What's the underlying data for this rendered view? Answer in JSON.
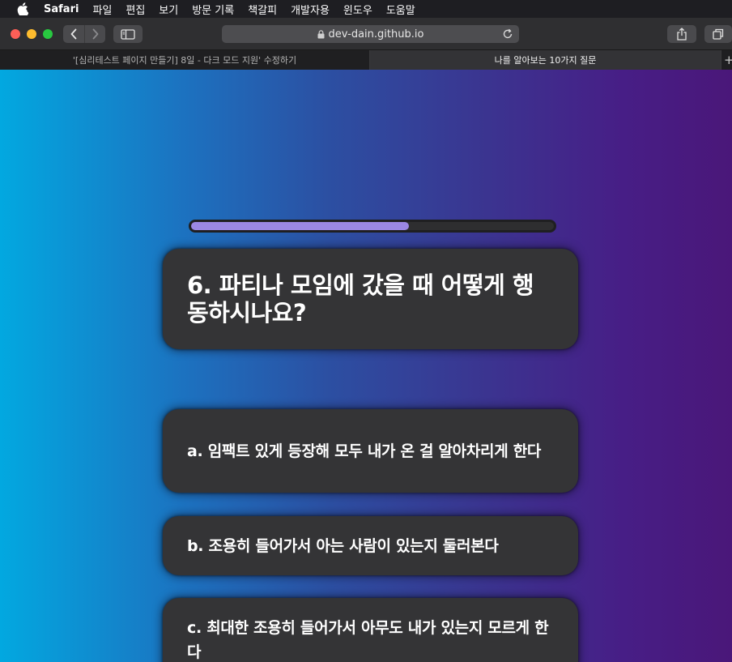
{
  "menubar": {
    "app_name": "Safari",
    "items": [
      "파일",
      "편집",
      "보기",
      "방문 기록",
      "책갈피",
      "개발자용",
      "윈도우",
      "도움말"
    ]
  },
  "toolbar": {
    "address": "dev-dain.github.io",
    "icons": [
      "back-icon",
      "forward-icon",
      "sidebar-icon",
      "lock-icon",
      "reload-icon",
      "share-icon",
      "tabs-overview-icon"
    ]
  },
  "tabs": [
    {
      "label": "'[심리테스트 페이지 만들기] 8일 - 다크 모드 지원' 수정하기",
      "active": false
    },
    {
      "label": "나를 알아보는 10가지 질문",
      "active": true
    }
  ],
  "new_tab_label": "+",
  "quiz": {
    "progress_fraction": 0.6,
    "question": "6. 파티나 모임에 갔을 때 어떻게 행동하시나요?",
    "answers": [
      "a. 임팩트 있게 등장해 모두 내가 온 걸 알아차리게 한다",
      "b. 조용히 들어가서 아는 사람이 있는지 둘러본다",
      "c. 최대한 조용히 들어가서 아무도 내가 있는지 모르게 한다"
    ]
  },
  "colors": {
    "gradient_start": "#02a8e0",
    "gradient_end": "#4a1779",
    "card_bg": "#343436",
    "progress_fill": "#9b87e3",
    "progress_track": "#2e2e30"
  }
}
